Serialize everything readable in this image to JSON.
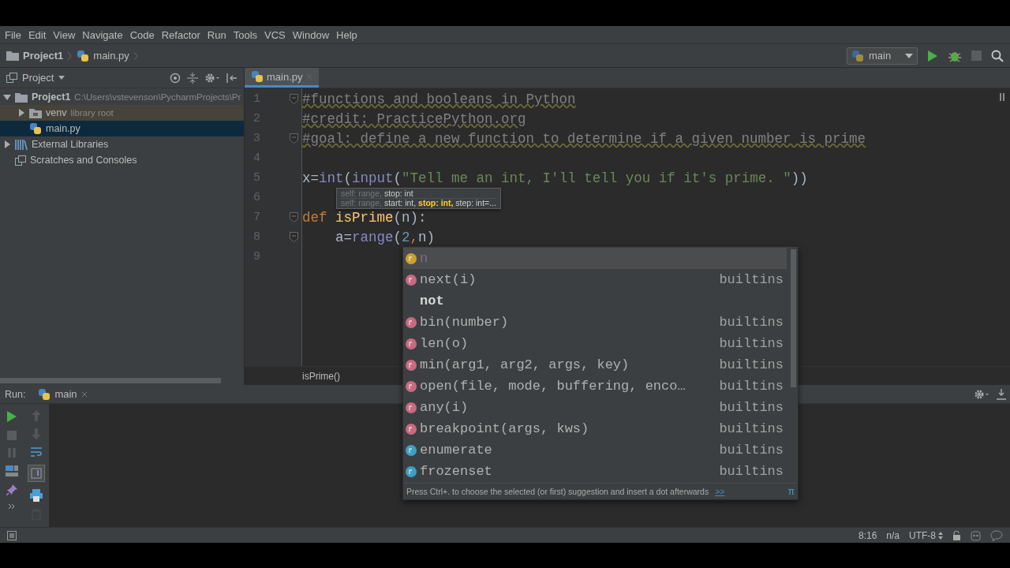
{
  "menu": [
    "File",
    "Edit",
    "View",
    "Navigate",
    "Code",
    "Refactor",
    "Run",
    "Tools",
    "VCS",
    "Window",
    "Help"
  ],
  "breadcrumbs": [
    {
      "label": "Project1",
      "kind": "folder"
    },
    {
      "label": "main.py",
      "kind": "python"
    }
  ],
  "run_config": {
    "label": "main"
  },
  "project_panel": {
    "title": "Project",
    "tree": [
      {
        "label": "Project1",
        "hint": "C:\\Users\\vstevenson\\PycharmProjects\\Pr",
        "kind": "folder",
        "expanded": true,
        "selected": false,
        "children": [
          {
            "label": "venv",
            "hint": "library root",
            "kind": "library-root",
            "expanded": false,
            "selected": false
          },
          {
            "label": "main.py",
            "kind": "python",
            "selected": true
          }
        ]
      },
      {
        "label": "External Libraries",
        "kind": "library",
        "expanded": false,
        "selected": false
      },
      {
        "label": "Scratches and Consoles",
        "kind": "scratch",
        "selected": false
      }
    ]
  },
  "editor": {
    "tabs": [
      {
        "label": "main.py",
        "selected": true
      }
    ],
    "lines": [
      {
        "number": "1",
        "fold": true,
        "tokens": [
          {
            "text": "#functions and booleans in Python",
            "kind": "comment"
          }
        ]
      },
      {
        "number": "2",
        "fold": false,
        "tokens": [
          {
            "text": "#credit: PracticePython.org",
            "kind": "comment"
          }
        ]
      },
      {
        "number": "3",
        "fold": true,
        "tokens": [
          {
            "text": "#goal: define a new function to determine if a given number is prime",
            "kind": "comment"
          }
        ]
      },
      {
        "number": "4",
        "fold": false
      },
      {
        "number": "5",
        "fold": false,
        "tokens": [
          {
            "text": "x",
            "kind": "plain"
          },
          {
            "text": "=",
            "kind": "plain"
          },
          {
            "text": "int",
            "kind": "builtin"
          },
          {
            "text": "(",
            "kind": "plain"
          },
          {
            "text": "input",
            "kind": "builtin"
          },
          {
            "text": "(",
            "kind": "plain"
          },
          {
            "text": "\"Tell me an int, I'll tell you if it's prime. \"",
            "kind": "string"
          },
          {
            "text": "))",
            "kind": "plain"
          }
        ]
      },
      {
        "number": "6",
        "fold": false
      },
      {
        "number": "7",
        "fold": true,
        "tokens": [
          {
            "text": "def ",
            "kind": "keyword"
          },
          {
            "text": "isPrime",
            "kind": "funcdef"
          },
          {
            "text": "(n):",
            "kind": "plain"
          }
        ]
      },
      {
        "number": "8",
        "fold": true,
        "tokens": [
          {
            "text": "    a",
            "kind": "plain"
          },
          {
            "text": "=",
            "kind": "plain"
          },
          {
            "text": "range",
            "kind": "builtin"
          },
          {
            "text": "(",
            "kind": "plain"
          },
          {
            "text": "2",
            "kind": "number"
          },
          {
            "text": ",",
            "kind": "punct"
          },
          {
            "text": "n)",
            "kind": "plain"
          }
        ]
      },
      {
        "number": "9",
        "fold": false
      }
    ],
    "breadcrumb": "isPrime()"
  },
  "param_tooltip": {
    "rows": [
      {
        "parts": [
          {
            "text": "self: range, ",
            "kind": "dim"
          },
          {
            "text": "stop: int",
            "kind": "normal"
          }
        ]
      },
      {
        "parts": [
          {
            "text": "self: range, ",
            "kind": "dim"
          },
          {
            "text": "start: int, ",
            "kind": "normal"
          },
          {
            "text": "stop: int, ",
            "kind": "current"
          },
          {
            "text": "step: int=...",
            "kind": "normal"
          }
        ]
      }
    ]
  },
  "completion": {
    "items": [
      {
        "kind": "parameter",
        "name": "n",
        "selected": true
      },
      {
        "kind": "function",
        "name": "next(i)",
        "source": "builtins",
        "selected": false
      },
      {
        "kind": "keyword",
        "name": "not",
        "selected": false
      },
      {
        "kind": "function",
        "name": "bin(number)",
        "source": "builtins",
        "selected": false
      },
      {
        "kind": "function",
        "name": "len(o)",
        "source": "builtins",
        "selected": false
      },
      {
        "kind": "function",
        "name": "min(arg1, arg2, args, key)",
        "source": "builtins",
        "selected": false
      },
      {
        "kind": "function",
        "name": "open(file, mode, buffering, enco…",
        "source": "builtins",
        "selected": false
      },
      {
        "kind": "function",
        "name": "any(i)",
        "source": "builtins",
        "selected": false
      },
      {
        "kind": "function",
        "name": "breakpoint(args, kws)",
        "source": "builtins",
        "selected": false
      },
      {
        "kind": "class",
        "name": "enumerate",
        "source": "builtins",
        "selected": false
      },
      {
        "kind": "class",
        "name": "frozenset",
        "source": "builtins",
        "selected": false
      }
    ],
    "hint": "Press Ctrl+. to choose the selected (or first) suggestion and insert a dot afterwards",
    "hint_link": ">>",
    "corner": "π"
  },
  "run_panel": {
    "label": "Run:",
    "tab": "main"
  },
  "status_bar": {
    "position": "8:16",
    "separator": "n/a",
    "encoding": "UTF-8"
  }
}
